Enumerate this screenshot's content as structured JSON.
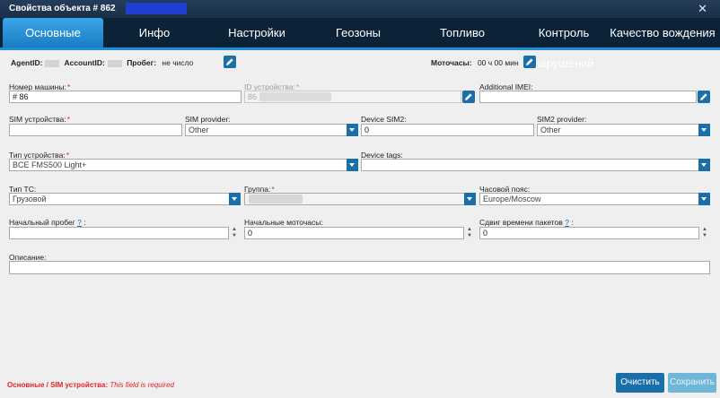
{
  "window": {
    "title": "Свойства объекта # 862",
    "close_glyph": "✕"
  },
  "tabs": [
    {
      "label": "Основные",
      "active": true
    },
    {
      "label": "Инфо"
    },
    {
      "label": "Настройки"
    },
    {
      "label": "Геозоны"
    },
    {
      "label": "Топливо"
    },
    {
      "label": "Контроль нарушений"
    },
    {
      "label": "Качество вождения"
    }
  ],
  "info": {
    "agent_label": "AgentID:",
    "account_label": "AccountID:",
    "mileage_label": "Пробег:",
    "mileage_value": "не число",
    "motohours_label": "Моточасы:",
    "motohours_value": "00 ч 00 мин"
  },
  "fields": {
    "vehicle_number": {
      "label": "Номер машины:",
      "value": "# 86"
    },
    "device_id": {
      "label": "ID устройства:",
      "value": "86"
    },
    "additional_imei": {
      "label": "Additional IMEI:",
      "value": ""
    },
    "sim": {
      "label": "SIM устройства:",
      "value": ""
    },
    "sim_provider": {
      "label": "SIM provider:",
      "value": "Other"
    },
    "device_sim2": {
      "label": "Device SIM2:",
      "value": "0"
    },
    "sim2_provider": {
      "label": "SIM2 provider:",
      "value": "Other"
    },
    "device_type": {
      "label": "Тип устройства:",
      "value": "BCE FMS500 Light+"
    },
    "device_tags": {
      "label": "Device tags:",
      "value": ""
    },
    "vehicle_type": {
      "label": "Тип ТС:",
      "value": "Грузовой"
    },
    "group": {
      "label": "Группа:",
      "value": ""
    },
    "timezone": {
      "label": "Часовой пояс:",
      "value": "Europe/Moscow"
    },
    "start_mileage": {
      "label": "Начальный пробег",
      "help": "?",
      "suffix": ":",
      "value": ""
    },
    "start_motohours": {
      "label": "Начальные моточасы:",
      "value": "0"
    },
    "time_shift": {
      "label": "Сдвиг времени пакетов",
      "help": "?",
      "suffix": ":",
      "value": "0"
    },
    "description": {
      "label": "Описание:",
      "value": ""
    }
  },
  "footer": {
    "path": "Основные / SIM устройства:",
    "error": "This field is required",
    "clear_label": "Очистить",
    "save_label": "Сохранить"
  },
  "colors": {
    "accent": "#1b6fa8",
    "tab_active": "#2a92dc",
    "required": "#e0262a"
  }
}
